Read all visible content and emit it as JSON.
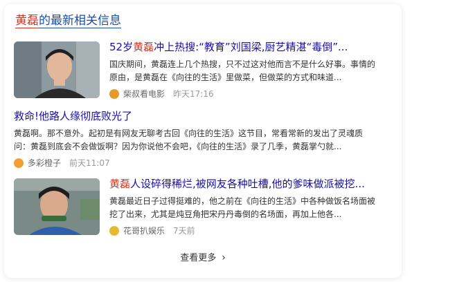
{
  "header": {
    "keyword": "黄磊",
    "title_suffix": "的最新相关信息"
  },
  "items": [
    {
      "title_prefix": "52岁",
      "title_keyword": "黄磊",
      "title_rest": "冲上热搜:“教育”刘国梁,厨艺精湛“毒倒”...",
      "snippet_line1": "国庆期间，黄磊连上几个热搜，只不过这对他而言不是什么好事。事情的",
      "snippet_line2": "原由，是黄磊在《向往的生活》里做菜，但做菜的方式和味道...",
      "source": "柴叔看电影",
      "time": "昨天17:16",
      "source_color": "#e59a2b"
    },
    {
      "title": "救命!他路人缘彻底败光了",
      "snippet_line1": "黄磊啊。那不意外。起初是有网友无聊考古回《向往的生活》这节目，常看常新的发出了灵魂质",
      "snippet_line2": "问：黄磊到底会不会做饭啊？因为你说他不会吧，《向往的生活》录了几季，黄磊掌勺就...",
      "source": "多彩橙子",
      "time": "前天11:07",
      "source_color": "#f0a030"
    },
    {
      "title_keyword": "黄磊",
      "title_rest": "人设碎得稀烂,被网友各种吐槽,他的爹味做派被挖...",
      "snippet_line1": "黄磊最近日子过得挺难的，他之前在《向往的生活》中各种做饭名场面被",
      "snippet_line2": "挖了出来，尤其是炖豆角把宋丹丹毒倒的名场面，再加上他各...",
      "source": "花哥扒娱乐",
      "time": "7天前",
      "source_color": "#e8b830"
    }
  ],
  "more_label": "查看更多"
}
